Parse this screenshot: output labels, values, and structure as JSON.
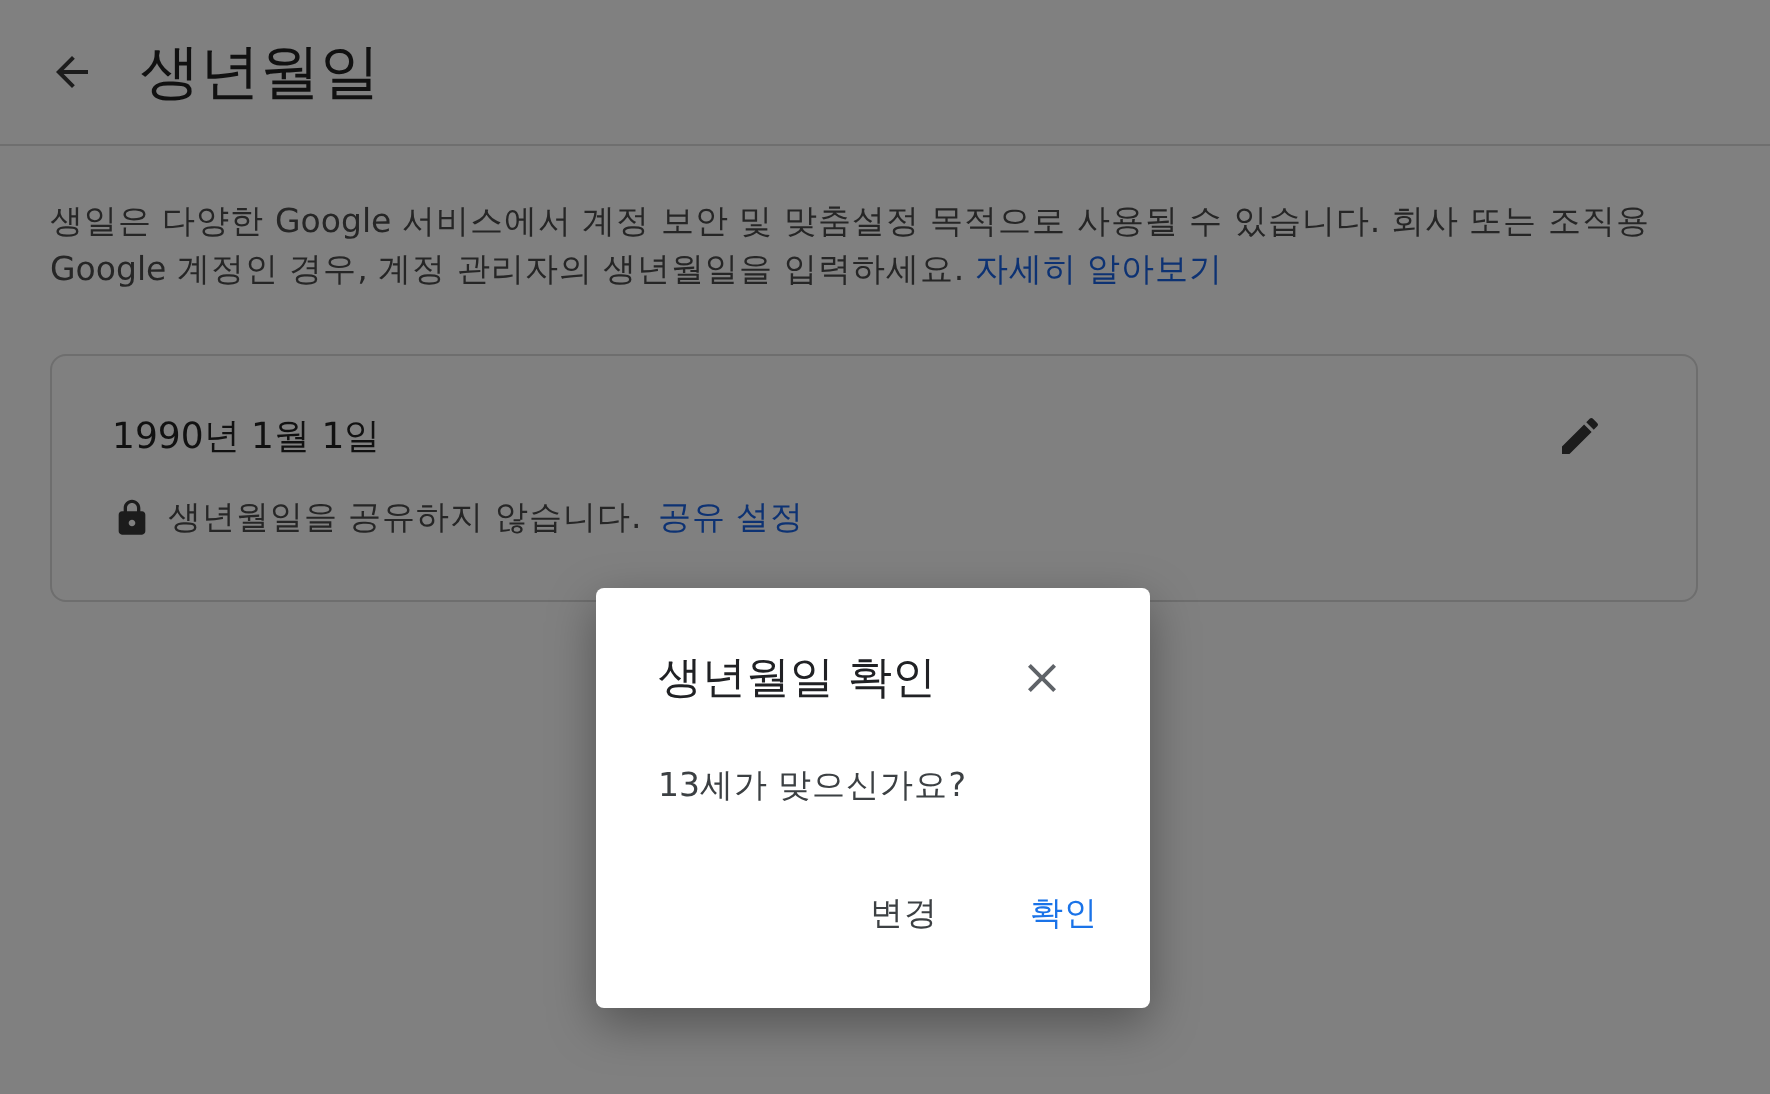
{
  "header": {
    "title": "생년월일"
  },
  "description": {
    "text": "생일은 다양한 Google 서비스에서 계정 보안 및 맞춤설정 목적으로 사용될 수 있습니다. 회사 또는 조직용 Google 계정인 경우, 계정 관리자의 생년월일을 입력하세요.",
    "link": "자세히 알아보기"
  },
  "card": {
    "date": "1990년 1월 1일",
    "privacy": "생년월일을 공유하지 않습니다.",
    "privacy_link": "공유 설정"
  },
  "dialog": {
    "title": "생년월일 확인",
    "message": "13세가 맞으신가요?",
    "buttons": [
      {
        "label": "변경",
        "kind": "secondary"
      },
      {
        "label": "확인",
        "kind": "primary"
      }
    ]
  }
}
